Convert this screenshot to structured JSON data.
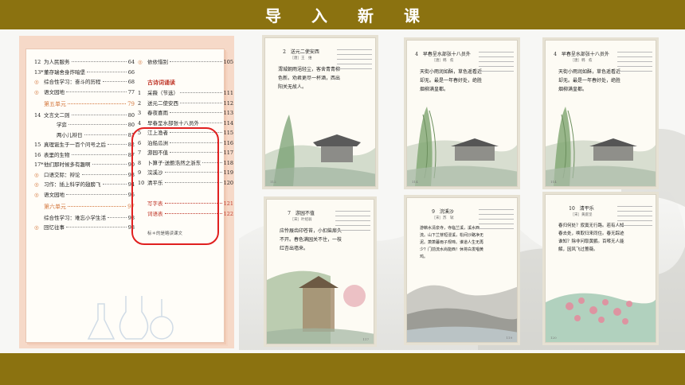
{
  "header": {
    "title": "导入新课"
  },
  "toc": {
    "left_rows": [
      {
        "num": "12",
        "title": "为人民服务",
        "page": "64",
        "type": "item"
      },
      {
        "num": "13*",
        "title": "董存瑞舍身炸暗堡",
        "page": "66",
        "type": "item"
      },
      {
        "num": "◎",
        "title": "综合性学习：奋斗的历程",
        "page": "68",
        "type": "dot"
      },
      {
        "num": "◎",
        "title": "语文园地",
        "page": "77",
        "type": "dot"
      },
      {
        "num": "",
        "title": "第五单元",
        "page": "79",
        "type": "unit"
      },
      {
        "num": "14",
        "title": "文言文二则",
        "page": "80",
        "type": "item"
      },
      {
        "num": "",
        "title": "学弈",
        "page": "80",
        "type": "indent"
      },
      {
        "num": "",
        "title": "两小儿辩日",
        "page": "81",
        "type": "indent"
      },
      {
        "num": "15",
        "title": "真理诞生于一百个问号之后",
        "page": "82",
        "type": "item"
      },
      {
        "num": "16",
        "title": "表里的生物",
        "page": "87",
        "type": "item"
      },
      {
        "num": "17*",
        "title": "他们那时候多有趣啊",
        "page": "90",
        "type": "item"
      },
      {
        "num": "◎",
        "title": "口语交际：辩论",
        "page": "93",
        "type": "dot"
      },
      {
        "num": "◎",
        "title": "习作：插上科学的翅膀飞",
        "page": "94",
        "type": "dot"
      },
      {
        "num": "◎",
        "title": "语文园地",
        "page": "95",
        "type": "dot"
      },
      {
        "num": "",
        "title": "第六单元",
        "page": "97",
        "type": "unit"
      },
      {
        "num": "",
        "title": "综合性学习：难忘小学生活",
        "page": "98",
        "type": "plain"
      },
      {
        "num": "◎",
        "title": "回忆往事",
        "page": "98",
        "type": "dot"
      }
    ],
    "right_rows": [
      {
        "num": "◎",
        "title": "依依惜别",
        "page": "105",
        "type": "dot"
      },
      {
        "num": "",
        "title": "",
        "page": "",
        "type": "gap"
      },
      {
        "num": "",
        "title": "古诗词诵读",
        "page": "",
        "type": "head"
      },
      {
        "num": "1",
        "title": "采薇（节选）",
        "page": "111",
        "type": "item"
      },
      {
        "num": "2",
        "title": "送元二使安西",
        "page": "112",
        "type": "item"
      },
      {
        "num": "3",
        "title": "春夜喜雨",
        "page": "113",
        "type": "item"
      },
      {
        "num": "4",
        "title": "早春呈水部张十八员外",
        "page": "114",
        "type": "item"
      },
      {
        "num": "5",
        "title": "江上渔者",
        "page": "115",
        "type": "item"
      },
      {
        "num": "6",
        "title": "泊船瓜洲",
        "page": "116",
        "type": "item"
      },
      {
        "num": "7",
        "title": "游园不值",
        "page": "117",
        "type": "item"
      },
      {
        "num": "8",
        "title": "卜算子·送鲍浩然之浙东",
        "page": "118",
        "type": "item"
      },
      {
        "num": "9",
        "title": "浣溪沙",
        "page": "119",
        "type": "item"
      },
      {
        "num": "10",
        "title": "清平乐",
        "page": "120",
        "type": "item"
      },
      {
        "num": "",
        "title": "",
        "page": "",
        "type": "gap"
      },
      {
        "num": "",
        "title": "写字表",
        "page": "121",
        "type": "red"
      },
      {
        "num": "",
        "title": "词语表",
        "page": "122",
        "type": "red"
      },
      {
        "num": "",
        "title": "",
        "page": "",
        "type": "gap"
      },
      {
        "num": "",
        "title": "标＊的是略读课文",
        "page": "",
        "type": "small"
      }
    ]
  },
  "pages": [
    {
      "title": "2　送元二使安西",
      "author": "［唐］王　维",
      "poem": "渭城朝雨浥轻尘，客舍青青柳色新。劝君更尽一杯酒，西出阳关无故人。",
      "number": "112"
    },
    {
      "title": "4　早春呈水部张十八员外",
      "author": "［唐］韩　愈",
      "poem": "天街小雨润如酥，草色遥看近却无。最是一年春好处，绝胜烟柳满皇都。",
      "number": "114"
    },
    {
      "title": "4　早春呈水部张十八员外",
      "author": "［唐］韩　愈",
      "poem": "天街小雨润如酥，草色遥看近却无。最是一年春好处，绝胜烟柳满皇都。",
      "number": "114"
    },
    {
      "title": "7　游园不值",
      "author": "［宋］叶绍翁",
      "poem": "应怜屐齿印苍苔，小扣柴扉久不开。春色满园关不住，一枝红杏出墙来。",
      "number": "117"
    },
    {
      "title": "9　浣溪沙",
      "author": "［宋］苏　轼",
      "poem": "游蕲水清泉寺，寺临兰溪，溪水西流。山下兰芽短浸溪，松间沙路净无泥。萧萧暮雨子规啼。谁道人生无再少？门前流水尚能西！休将白发唱黄鸡。",
      "number": "119"
    },
    {
      "title": "10　清平乐",
      "author": "［宋］黄庭坚",
      "poem": "春归何处？寂寞无行路。若有人知春去处，唤取归来同住。春无踪迹谁知？除非问取黄鹂。百啭无人能解，因风飞过蔷薇。",
      "number": "120"
    }
  ]
}
